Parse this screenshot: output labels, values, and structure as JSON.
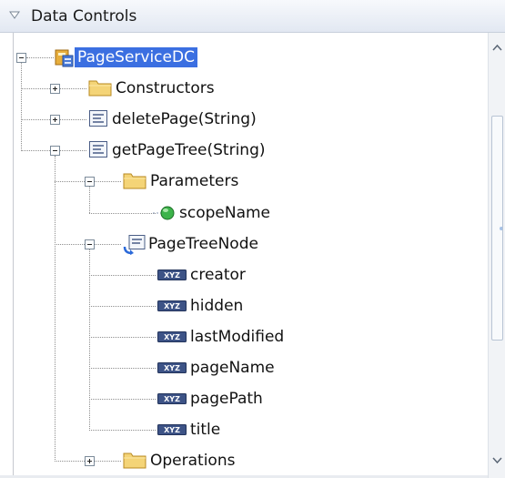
{
  "panel": {
    "title": "Data Controls"
  },
  "tree": {
    "items": [
      {
        "label": "PageServiceDC",
        "icon": "data-control-icon",
        "expander": "minus",
        "selected": true
      },
      {
        "label": "Constructors",
        "icon": "folder-icon",
        "expander": "plus"
      },
      {
        "label": "deletePage(String)",
        "icon": "method-icon",
        "expander": "plus"
      },
      {
        "label": "getPageTree(String)",
        "icon": "method-icon",
        "expander": "minus"
      },
      {
        "label": "Parameters",
        "icon": "folder-icon",
        "expander": "minus"
      },
      {
        "label": "scopeName",
        "icon": "parameter-icon"
      },
      {
        "label": "PageTreeNode",
        "icon": "return-collection-icon",
        "expander": "minus"
      },
      {
        "label": "creator",
        "icon": "attribute-icon"
      },
      {
        "label": "hidden",
        "icon": "attribute-icon"
      },
      {
        "label": "lastModified",
        "icon": "attribute-icon"
      },
      {
        "label": "pageName",
        "icon": "attribute-icon"
      },
      {
        "label": "pagePath",
        "icon": "attribute-icon"
      },
      {
        "label": "title",
        "icon": "attribute-icon"
      },
      {
        "label": "Operations",
        "icon": "folder-icon",
        "expander": "plus"
      }
    ]
  },
  "colors": {
    "selection": "#3b6fe1",
    "header_bg": "#e2e8f2",
    "folder": "#f4d477"
  },
  "scrollbar": {
    "position": 0.35,
    "visible_fraction": 0.55
  }
}
